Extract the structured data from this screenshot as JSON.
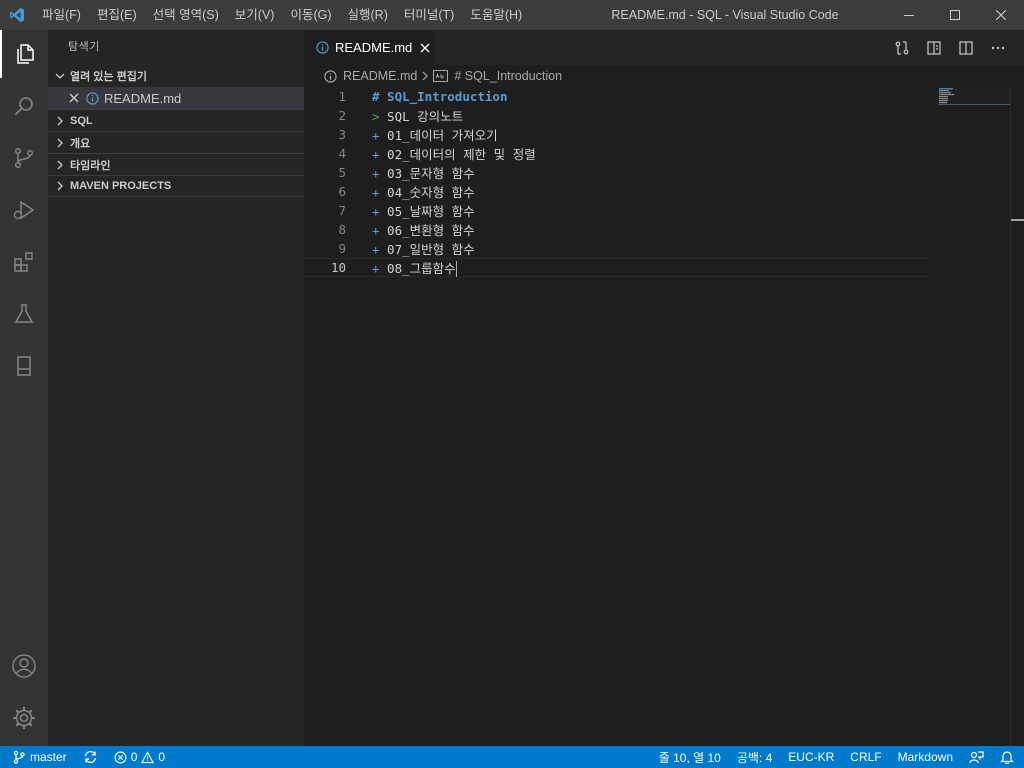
{
  "window": {
    "title": "README.md - SQL - Visual Studio Code",
    "menu": [
      "파일(F)",
      "편집(E)",
      "선택 영역(S)",
      "보기(V)",
      "이동(G)",
      "실행(R)",
      "터미널(T)",
      "도움말(H)"
    ]
  },
  "activity": {
    "items": [
      "explorer-icon",
      "search-icon",
      "source-control-icon",
      "run-debug-icon",
      "extensions-icon",
      "testing-icon",
      "remote-explorer-icon"
    ],
    "bottom": [
      "account-icon",
      "settings-gear-icon"
    ]
  },
  "sidebar": {
    "title": "탐색기",
    "open_editors": "열려 있는 편집기",
    "open_file": "README.md",
    "sections": [
      "SQL",
      "개요",
      "타임라인",
      "MAVEN PROJECTS"
    ]
  },
  "tab": {
    "label": "README.md"
  },
  "breadcrumb": {
    "file": "README.md",
    "symbol": "# SQL_Introduction"
  },
  "editor": {
    "lines": [
      {
        "n": "1",
        "mark": "#",
        "text": " SQL_Introduction"
      },
      {
        "n": "2",
        "mark": ">",
        "text": " SQL 강의노트"
      },
      {
        "n": "3",
        "mark": "+",
        "text": " 01_데이터 가져오기"
      },
      {
        "n": "4",
        "mark": "+",
        "text": " 02_데이터의 제한 및 정렬"
      },
      {
        "n": "5",
        "mark": "+",
        "text": " 03_문자형 함수"
      },
      {
        "n": "6",
        "mark": "+",
        "text": " 04_숫자형 함수"
      },
      {
        "n": "7",
        "mark": "+",
        "text": " 05_날짜형 함수"
      },
      {
        "n": "8",
        "mark": "+",
        "text": " 06_변환형 함수"
      },
      {
        "n": "9",
        "mark": "+",
        "text": " 07_일반형 함수"
      },
      {
        "n": "10",
        "mark": "+",
        "text": " 08_그룹함수"
      }
    ]
  },
  "status": {
    "branch": "master",
    "errors": "0",
    "warnings": "0",
    "position": "줄 10, 열 10",
    "spaces": "공백: 4",
    "encoding": "EUC-KR",
    "eol": "CRLF",
    "language": "Markdown"
  },
  "colors": {
    "accent": "#007acc",
    "activity_bg": "#333333",
    "sidebar_bg": "#252526",
    "editor_bg": "#1e1e1e"
  }
}
